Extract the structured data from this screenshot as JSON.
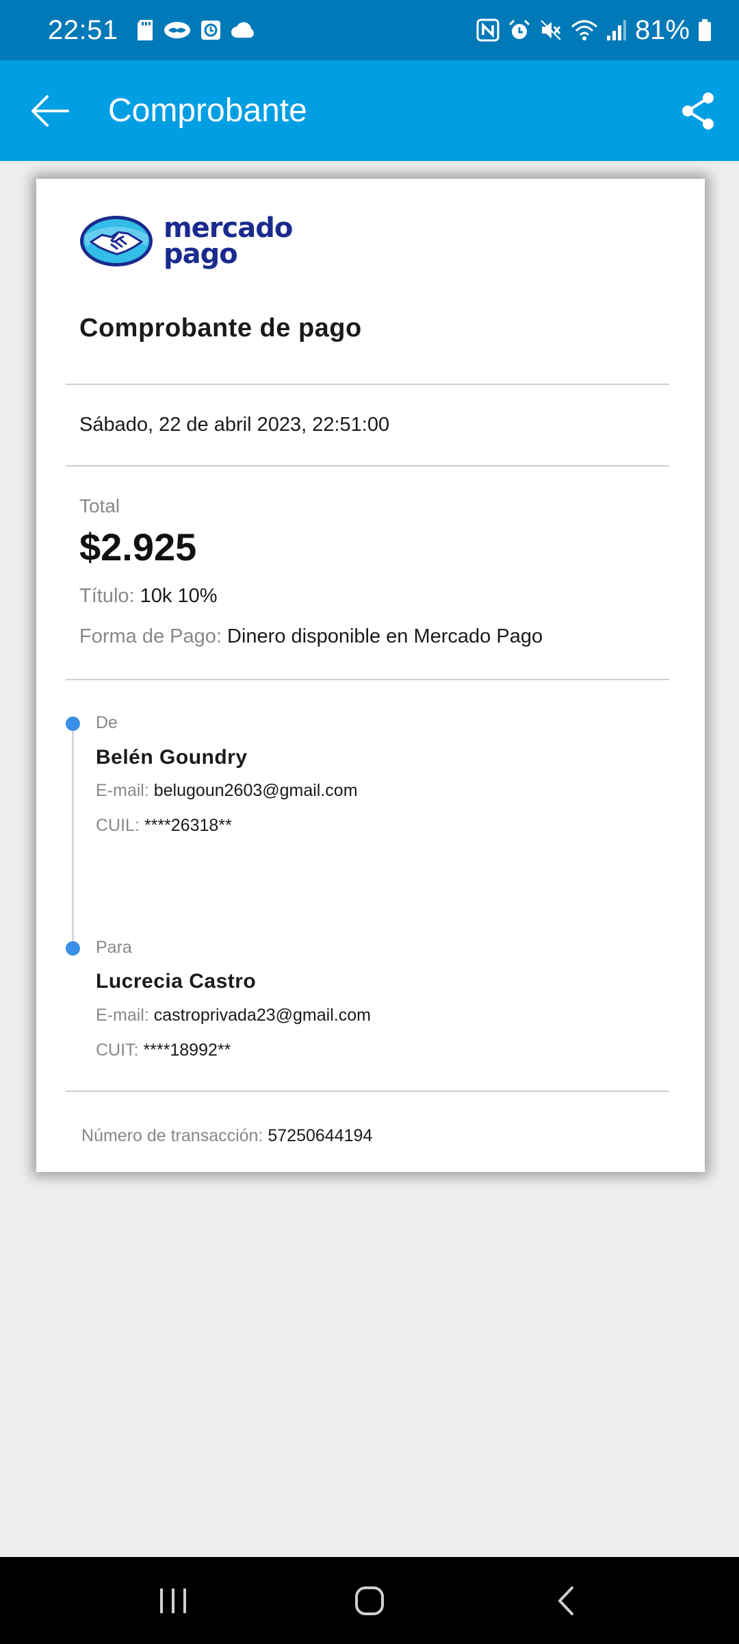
{
  "status_bar": {
    "time": "22:51",
    "battery": "81%",
    "left_icons": [
      "sd-card-icon",
      "handshake-icon",
      "clock-app-icon",
      "cloud-icon"
    ],
    "right_icons": [
      "nfc-icon",
      "alarm-icon",
      "mute-icon",
      "wifi-icon",
      "signal-icon",
      "battery-icon"
    ]
  },
  "app_bar": {
    "title": "Comprobante",
    "back_icon": "arrow-left-icon",
    "share_icon": "share-icon"
  },
  "receipt": {
    "logo": {
      "line1": "mercado",
      "line2": "pago"
    },
    "title": "Comprobante de pago",
    "date": "Sábado, 22 de abril 2023, 22:51:00",
    "total_label": "Total",
    "total_amount": "$2.925",
    "titulo_label": "Título:",
    "titulo_value": "10k 10%",
    "payment_method_label": "Forma de Pago:",
    "payment_method_value": "Dinero disponible en Mercado Pago",
    "from": {
      "role": "De",
      "name": "Belén Goundry",
      "email_label": "E-mail:",
      "email": "belugoun2603@gmail.com",
      "id_label": "CUIL:",
      "id": "****26318**"
    },
    "to": {
      "role": "Para",
      "name": "Lucrecia Castro",
      "email_label": "E-mail:",
      "email": "castroprivada23@gmail.com",
      "id_label": "CUIT:",
      "id": "****18992**"
    },
    "transaction_label": "Número de transacción:",
    "transaction_number": "57250644194"
  },
  "nav_bar": {
    "buttons": [
      "recent-apps-icon",
      "home-icon",
      "back-icon"
    ]
  },
  "colors": {
    "status_bar": "#0079b8",
    "app_bar": "#009ee3",
    "timeline_dot": "#3a8fe8",
    "logo_blue": "#1a2a8e"
  }
}
